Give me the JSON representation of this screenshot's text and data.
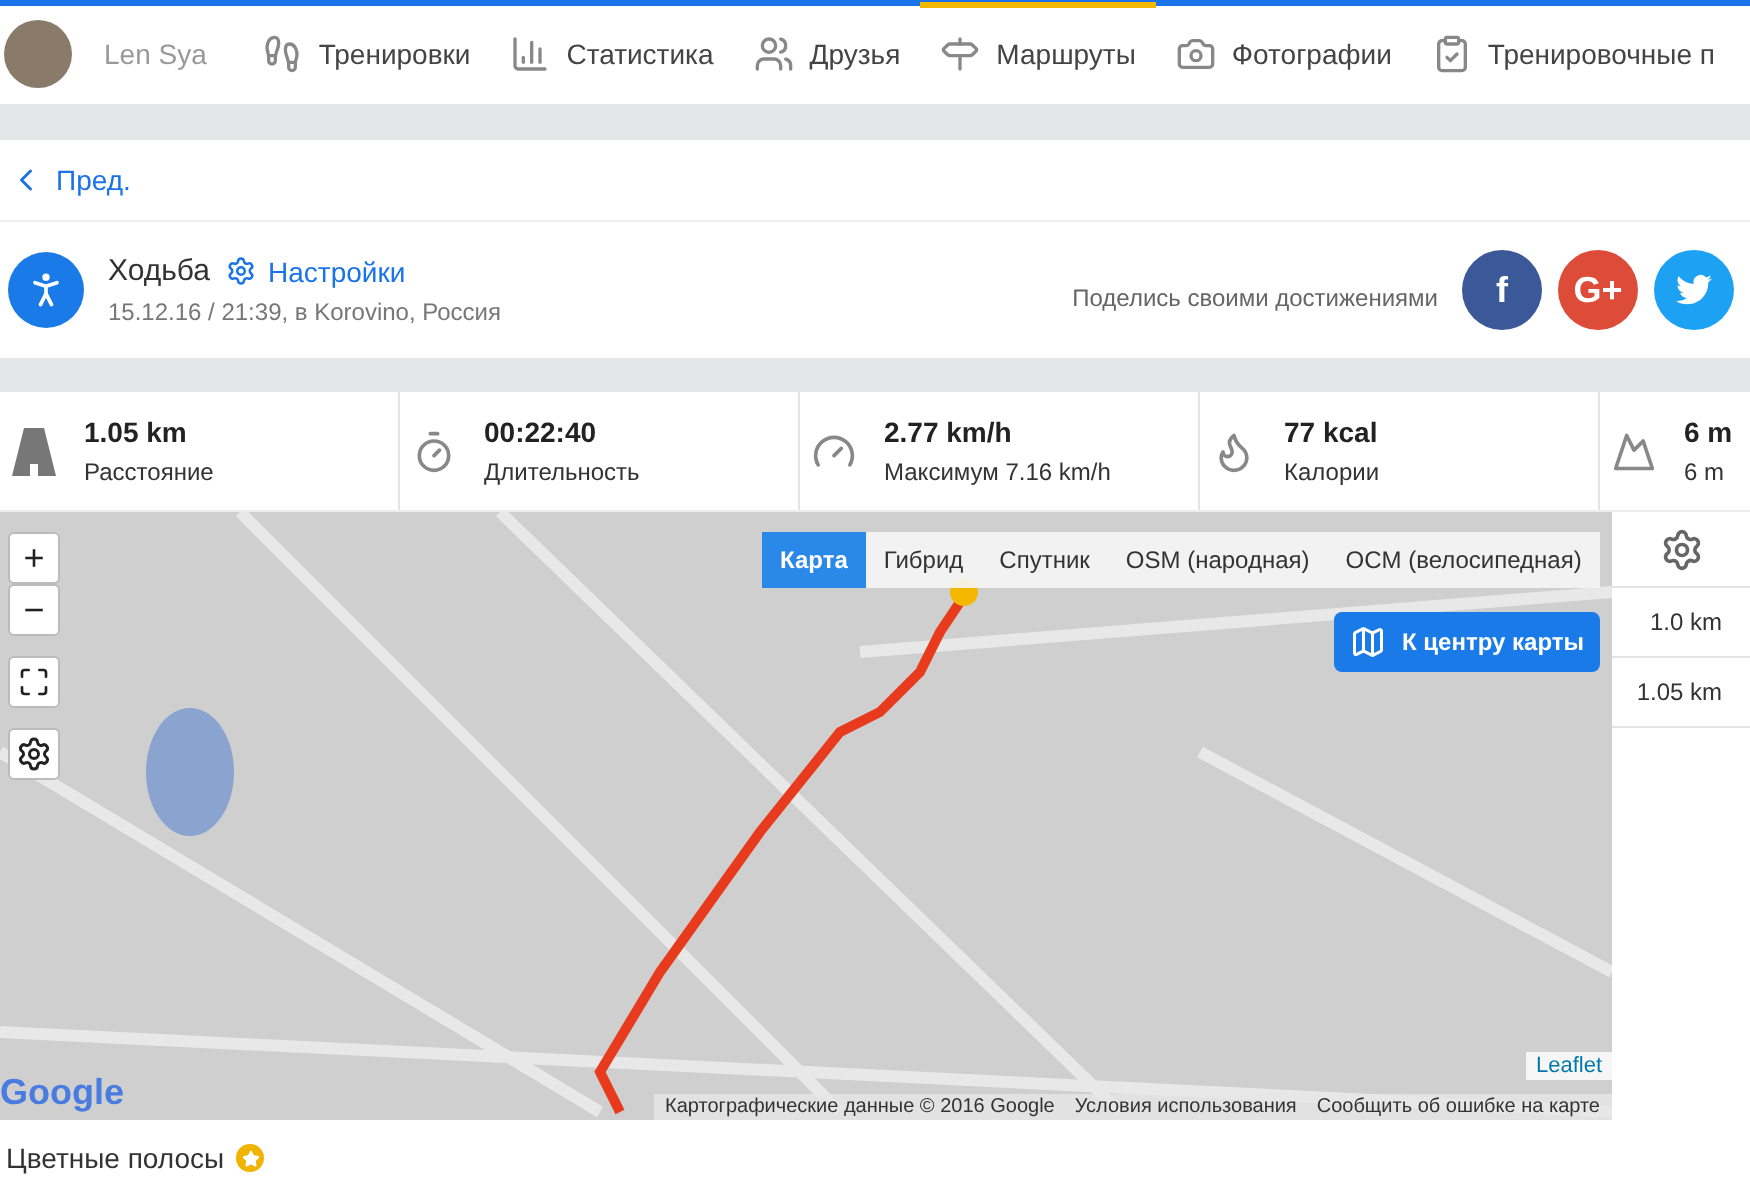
{
  "nav": {
    "user": "Len Sya",
    "items": [
      {
        "label": "Тренировки",
        "selected": false
      },
      {
        "label": "Статистика",
        "selected": false
      },
      {
        "label": "Друзья",
        "selected": false
      },
      {
        "label": "Маршруты",
        "selected": true
      },
      {
        "label": "Фотографии",
        "selected": false
      },
      {
        "label": "Тренировочные п",
        "selected": false
      }
    ]
  },
  "back": "Пред.",
  "workout": {
    "title": "Ходьба",
    "settings": "Настройки",
    "subtitle": "15.12.16 / 21:39, в Korovino, Россия",
    "share": "Поделись своими достижениями",
    "social": [
      {
        "kind": "facebook",
        "label": "f",
        "color": "#3b5998"
      },
      {
        "kind": "google",
        "label": "G+",
        "color": "#dd4b39"
      },
      {
        "kind": "twitter",
        "color": "#1da1f2"
      }
    ]
  },
  "stats": [
    {
      "value": "1.05 km",
      "label": "Расстояние"
    },
    {
      "value": "00:22:40",
      "label": "Длительность"
    },
    {
      "value": "2.77 km/h",
      "label": "Максимум 7.16 km/h"
    },
    {
      "value": "77 kcal",
      "label": "Калории"
    },
    {
      "value": "6 m",
      "label": "6 m"
    }
  ],
  "map": {
    "layers": [
      {
        "label": "Карта",
        "selected": true
      },
      {
        "label": "Гибрид",
        "selected": false
      },
      {
        "label": "Спутник",
        "selected": false
      },
      {
        "label": "OSM (народная)",
        "selected": false
      },
      {
        "label": "OCM (велосипедная)",
        "selected": false
      }
    ],
    "center_button": "К центру карты",
    "zoom_in": "+",
    "zoom_out": "−",
    "logo": "Google",
    "leaflet": "Leaflet",
    "attribution": [
      "Картографические данные © 2016 Google",
      "Условия использования",
      "Сообщить об ошибке на карте"
    ]
  },
  "splits": [
    "1.0 km",
    "1.05 km"
  ],
  "footer": {
    "label": "Цветные полосы"
  }
}
